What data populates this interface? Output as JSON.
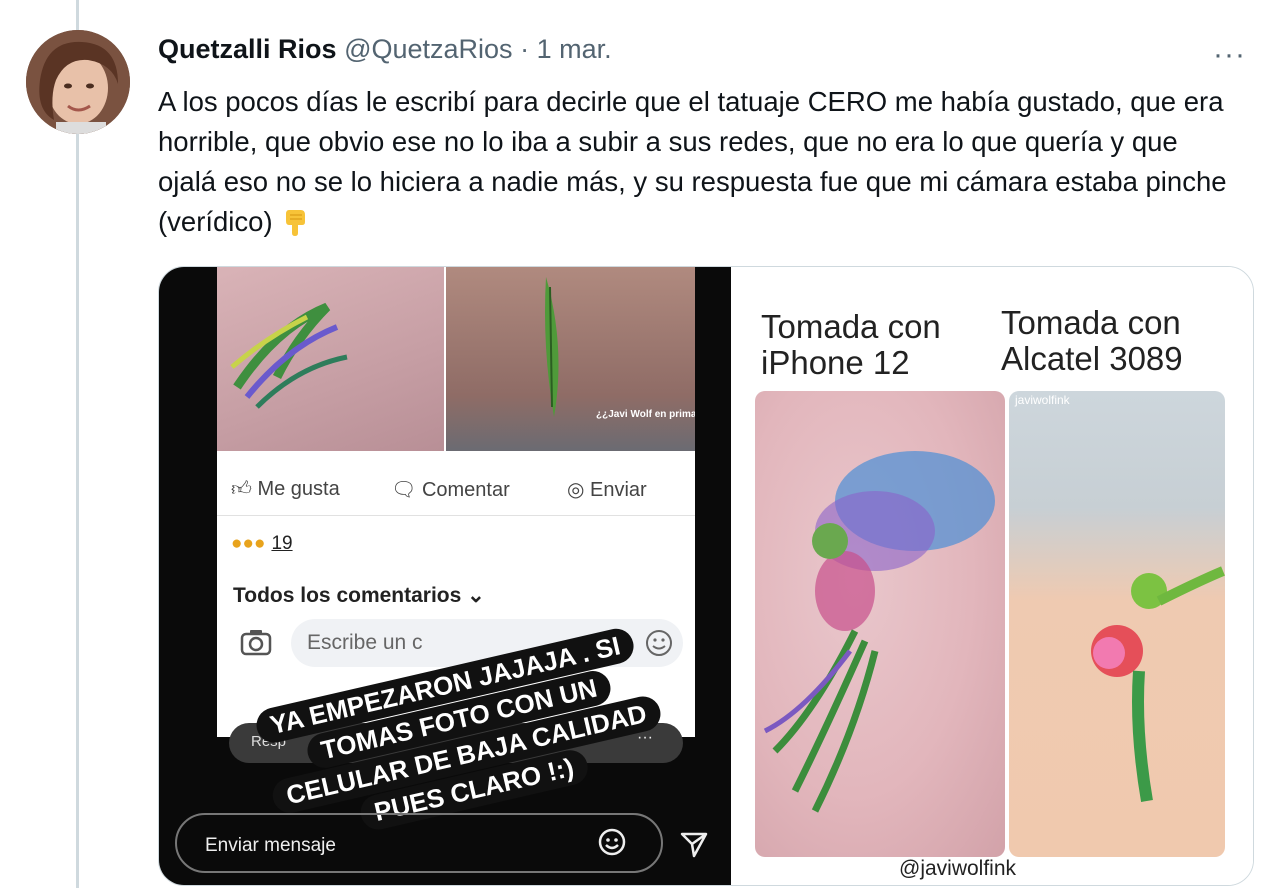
{
  "tweet": {
    "display_name": "Quetzalli Rios",
    "handle": "@QuetzaRios",
    "separator": "·",
    "date": "1 mar.",
    "more_label": "···",
    "text": "A los pocos días le escribí para decirle que el tatuaje CERO me había gustado, que era horrible, que obvio ese no lo iba a subir a sus redes, que no era lo que quería y que ojalá eso no se lo hiciera a nadie más, y su respuesta fue que mi cámara estaba pinche (verídico)"
  },
  "media": {
    "left": {
      "img2_caption": "¿¿Javi Wolf en primaria??",
      "actions": {
        "like": "Me gusta",
        "comment": "Comentar",
        "send": "Enviar"
      },
      "reaction_count": "19",
      "comments_header": "Todos los comentarios",
      "comment_placeholder": "Escribe un c",
      "reply_text": "Resp",
      "reply_dots": "···",
      "sticker_lines": [
        "YA EMPEZARON JAJAJA . SI",
        "TOMAS FOTO CON UN",
        "CELULAR DE BAJA CALIDAD",
        "PUES CLARO !:)"
      ],
      "send_placeholder": "Enviar mensaje"
    },
    "right": {
      "caption_left": "Tomada con iPhone 12",
      "caption_right": "Tomada con Alcatel 3089",
      "photo2_handle": "javiwolfink",
      "credit": "@javiwolfink"
    }
  },
  "colors": {
    "text": "#0f1419",
    "muted": "#536471",
    "border": "#cfd9de"
  }
}
